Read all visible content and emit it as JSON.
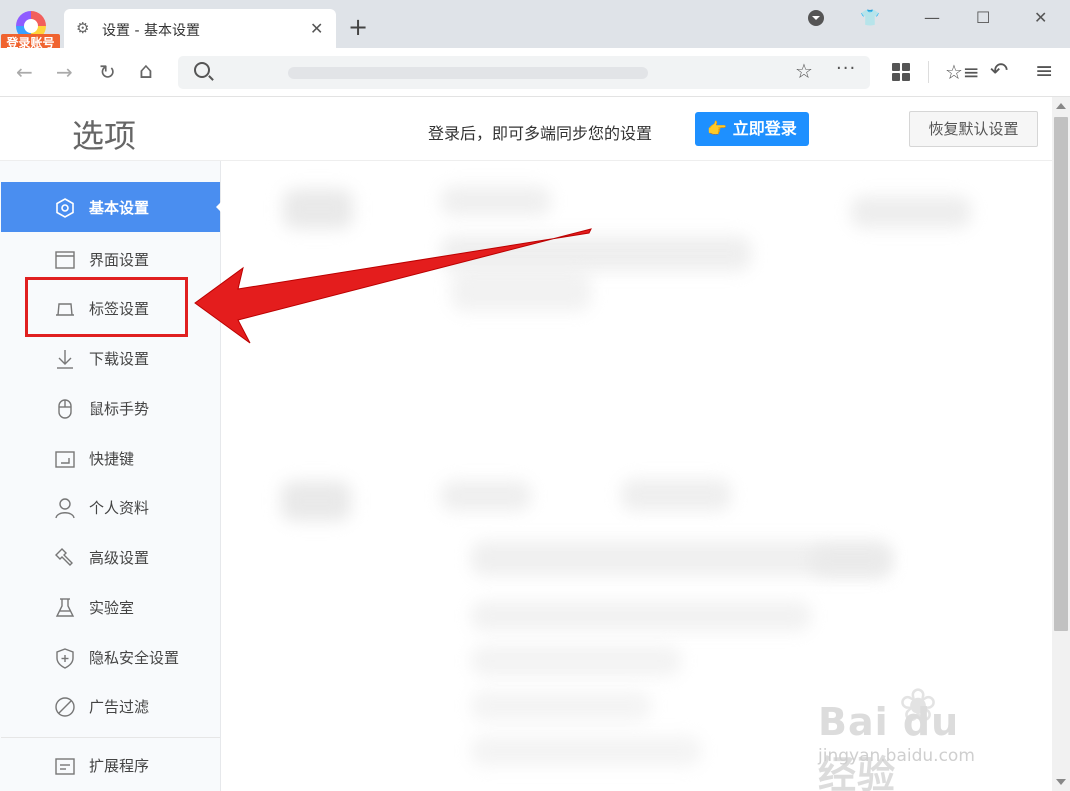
{
  "titlebar": {
    "login_badge": "登录账号",
    "tab_title": "设置 - 基本设置",
    "tab_close": "✕",
    "new_tab": "+"
  },
  "window_controls": {
    "skin": "👕",
    "minimize": "—",
    "maximize": "☐",
    "close": "✕"
  },
  "navbar": {
    "back": "←",
    "forward": "→",
    "reload": "↻",
    "home": "⌂",
    "address_value": ""
  },
  "header": {
    "title": "选项",
    "sync_text": "登录后，即可多端同步您的设置",
    "login_button": "👉 立即登录",
    "restore_button": "恢复默认设置"
  },
  "sidebar": {
    "items": [
      {
        "label": "基本设置",
        "icon": "settings-icon",
        "active": true
      },
      {
        "label": "界面设置",
        "icon": "window-icon",
        "active": false
      },
      {
        "label": "标签设置",
        "icon": "tab-icon",
        "active": false
      },
      {
        "label": "下载设置",
        "icon": "download-icon",
        "active": false
      },
      {
        "label": "鼠标手势",
        "icon": "mouse-icon",
        "active": false
      },
      {
        "label": "快捷键",
        "icon": "keyboard-icon",
        "active": false
      },
      {
        "label": "个人资料",
        "icon": "user-icon",
        "active": false
      },
      {
        "label": "高级设置",
        "icon": "wrench-icon",
        "active": false
      },
      {
        "label": "实验室",
        "icon": "flask-icon",
        "active": false
      },
      {
        "label": "隐私安全设置",
        "icon": "shield-icon",
        "active": false
      },
      {
        "label": "广告过滤",
        "icon": "block-icon",
        "active": false
      },
      {
        "label": "扩展程序",
        "icon": "extension-icon",
        "active": false
      }
    ]
  },
  "colors": {
    "accent": "#4a8ef0",
    "login_button": "#1e90ff",
    "annotation": "#e02020",
    "badge": "#f0632f"
  },
  "watermark": {
    "main": "Bai du 经验",
    "url": "jingyan.baidu.com"
  }
}
